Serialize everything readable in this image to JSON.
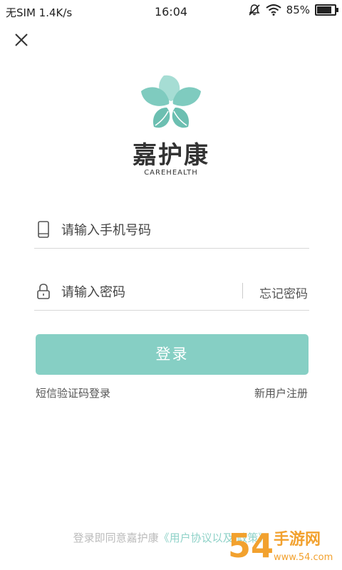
{
  "status_bar": {
    "carrier": "无SIM",
    "speed": "1.4K/s",
    "time": "16:04",
    "battery": "85%",
    "battery_level": 0.85
  },
  "brand": {
    "name": "嘉护康",
    "subtitle": "CAREHEALTH",
    "accent_color": "#86cfc4"
  },
  "form": {
    "phone_placeholder": "请输入手机号码",
    "password_placeholder": "请输入密码",
    "forgot_label": "忘记密码"
  },
  "actions": {
    "login_label": "登录",
    "sms_login_label": "短信验证码登录",
    "register_label": "新用户注册"
  },
  "footer": {
    "agreement_prefix": "登录即同意嘉护康",
    "agreement_link": "《用户协议以及   政策》"
  },
  "watermark": {
    "text_main": "54",
    "text_sub": "手游网",
    "text_url": "www.54.com"
  }
}
